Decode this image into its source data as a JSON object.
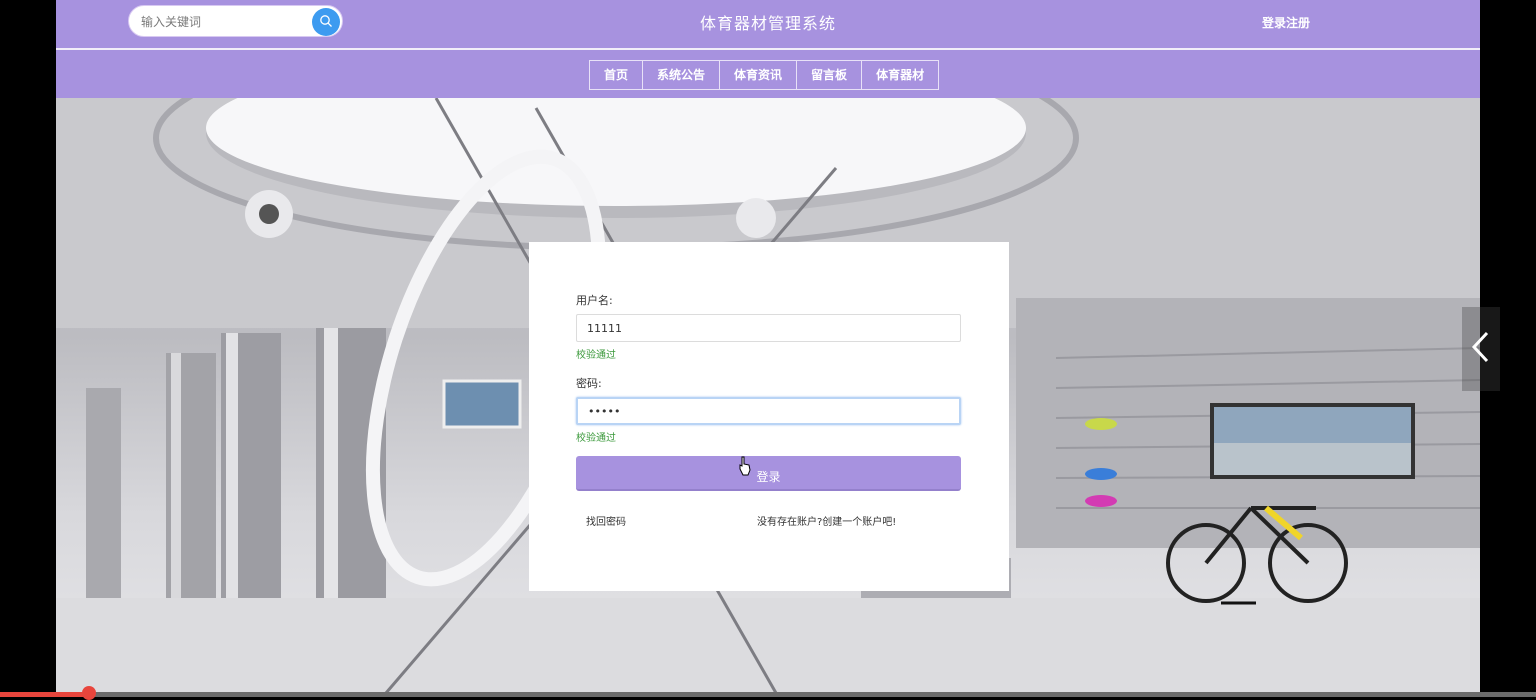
{
  "header": {
    "search": {
      "placeholder": "输入关键词"
    },
    "site_title": "体育器材管理系统",
    "auth_link": "登录注册"
  },
  "nav": {
    "items": [
      "首页",
      "系统公告",
      "体育资讯",
      "留言板",
      "体育器材"
    ]
  },
  "login": {
    "username_label": "用户名:",
    "username_value": "11111",
    "username_status": "校验通过",
    "password_label": "密码:",
    "password_value": "11111",
    "password_status": "校验通过",
    "submit_label": "登录",
    "forgot_link": "找回密码",
    "register_link": "没有存在账户?创建一个账户吧!"
  },
  "colors": {
    "theme": "#a792df",
    "search_button": "#3d9bf0",
    "valid_text": "#3c9a3c",
    "progress": "#e8453c"
  },
  "icons": {
    "search": "search-icon",
    "slider_prev": "chevron-left-icon"
  },
  "video_progress": 0.058
}
